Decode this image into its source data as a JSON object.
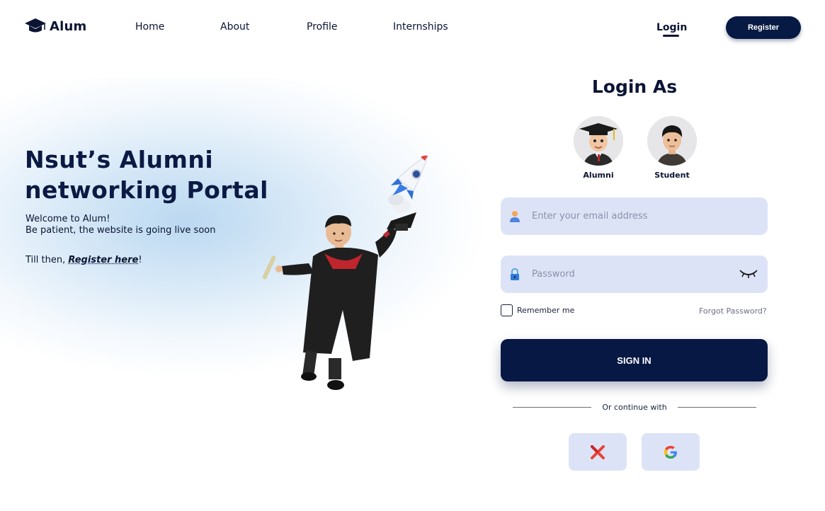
{
  "brand": {
    "name": "Alum",
    "icon": "graduation-cap-icon"
  },
  "nav": {
    "links": [
      "Home",
      "About",
      "Profile",
      "Internships"
    ],
    "login": "Login",
    "register": "Register"
  },
  "hero": {
    "title": "Nsut’s Alumni networking Portal",
    "line1": "Welcome to Alum!",
    "line2": "Be patient, the website is going live soon",
    "cta_prefix": "Till then, ",
    "cta_link": "Register here",
    "cta_suffix": "!",
    "illustration": "graduate-with-rocket-illustration"
  },
  "login": {
    "title": "Login As",
    "roles": [
      {
        "label": "Alumni",
        "icon": "graduate-avatar-icon"
      },
      {
        "label": "Student",
        "icon": "student-avatar-icon"
      }
    ],
    "email_placeholder": "Enter your email address",
    "password_placeholder": "Password",
    "remember_label": "Remember me",
    "forgot_label": "Forgot Password?",
    "signin_label": "SIGN IN",
    "divider": "Or continue with",
    "social": [
      {
        "icon": "x-logo-icon",
        "color": "#ea4335"
      },
      {
        "icon": "google-logo-icon",
        "color": "#4285f4"
      }
    ]
  },
  "colors": {
    "primary": "#061843",
    "field_bg": "#dde3f7",
    "text": "#0b1433",
    "glow": "#b7d6f0"
  }
}
